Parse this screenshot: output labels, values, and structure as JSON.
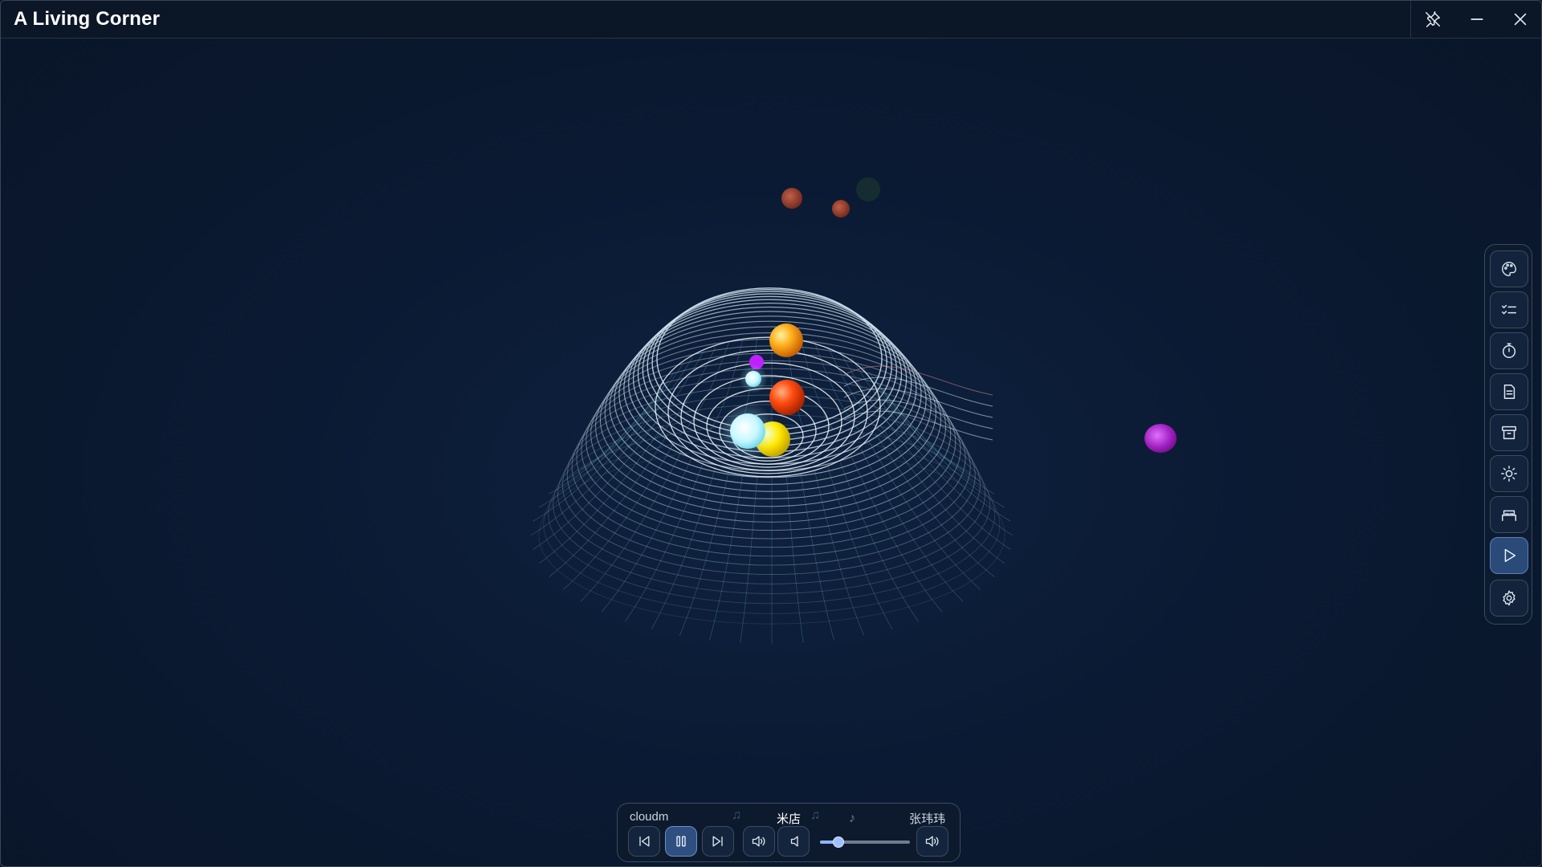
{
  "window": {
    "title": "A Living Corner"
  },
  "titlebar": {
    "buttons": [
      {
        "name": "unpin-button",
        "icon": "unpin-icon"
      },
      {
        "name": "minimize-button",
        "icon": "minimize-icon"
      },
      {
        "name": "close-button",
        "icon": "close-icon"
      }
    ]
  },
  "side_toolbar": {
    "items": [
      {
        "icon": "palette-icon",
        "active": false
      },
      {
        "icon": "checklist-icon",
        "active": false
      },
      {
        "icon": "timer-icon",
        "active": false
      },
      {
        "icon": "note-icon",
        "active": false
      },
      {
        "icon": "archive-icon",
        "active": false
      },
      {
        "icon": "sun-icon",
        "active": false
      },
      {
        "icon": "bed-icon",
        "active": false
      },
      {
        "icon": "play-icon",
        "active": true
      },
      {
        "icon": "settings-icon",
        "active": false
      }
    ]
  },
  "player": {
    "source": "cloudm",
    "track_title": "米店",
    "artist": "张玮玮",
    "state": "playing",
    "volume": 0.2,
    "controls": [
      "previous-icon",
      "pause-icon",
      "next-icon",
      "volume-up-icon",
      "volume-down-icon",
      "volume-icon"
    ]
  },
  "colors": {
    "background": "#0a1830",
    "grid": "#cfe4f0",
    "accent": "#5b7fb5",
    "orb_orange": "#ffa21a",
    "orb_red": "#ff4a10",
    "orb_yellow": "#ffe600",
    "orb_cyan": "#bff6ff",
    "orb_magenta": "#a020c0"
  }
}
